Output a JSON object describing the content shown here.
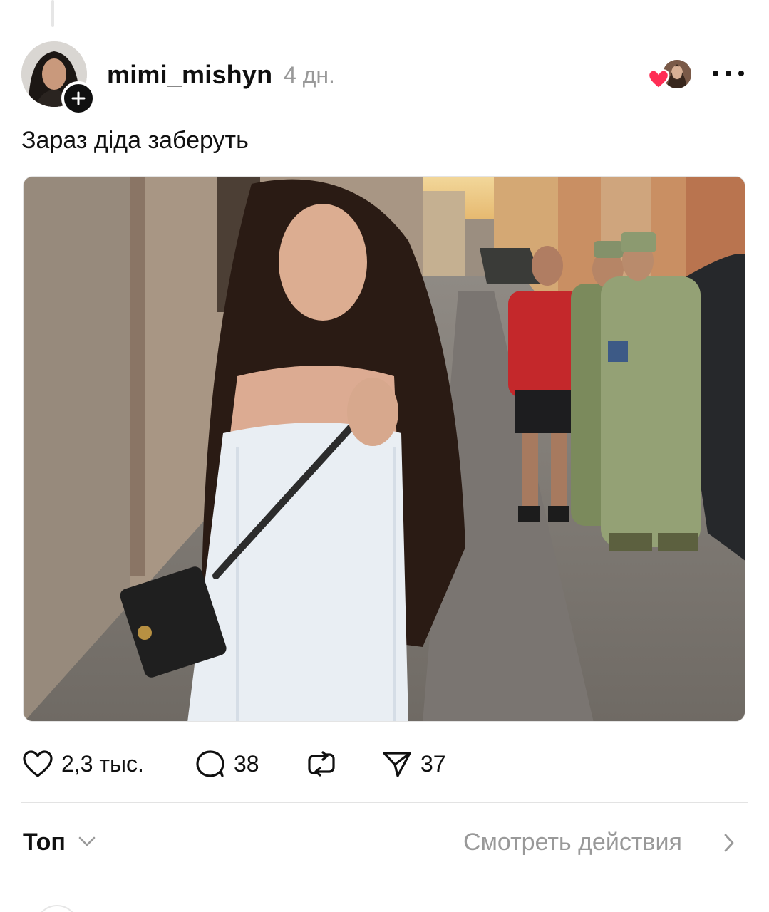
{
  "post": {
    "username": "mimi_mishyn",
    "time": "4 дн.",
    "text": "Зараз діда заберуть"
  },
  "icons": {
    "follow": "plus-icon",
    "liked_by": "heart-icon",
    "more": "more-horizontal-icon",
    "like": "heart-outline-icon",
    "comment": "comment-bubble-icon",
    "repost": "repost-icon",
    "share": "send-icon",
    "sort": "chevron-down-icon",
    "activity": "chevron-right-icon"
  },
  "colors": {
    "heart_red": "#ff2d55",
    "text_primary": "#101010",
    "text_secondary": "#999999"
  },
  "actions": {
    "likes": "2,3 тыс.",
    "comments": "38",
    "shares": "37"
  },
  "replies_bar": {
    "sort_label": "Топ",
    "activity_label": "Смотреть действия"
  }
}
